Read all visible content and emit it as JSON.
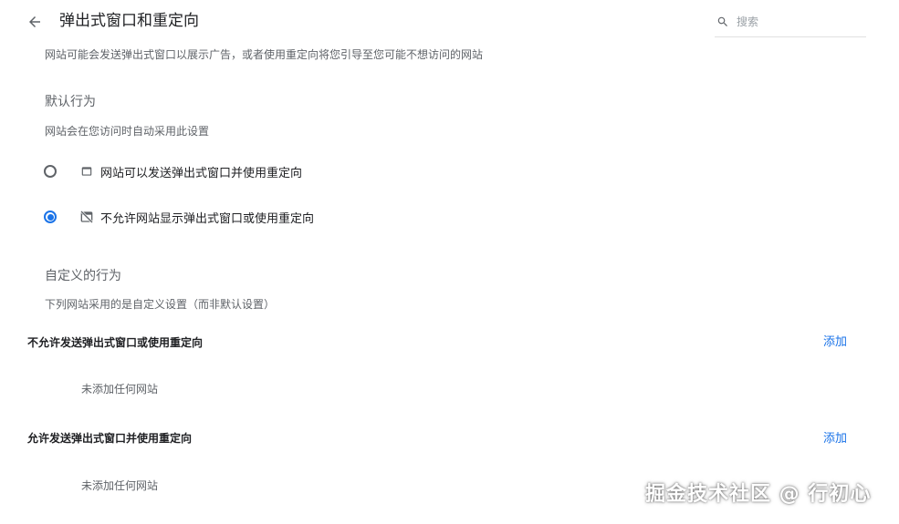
{
  "header": {
    "title": "弹出式窗口和重定向",
    "back_icon": "arrow-left-icon",
    "search": {
      "placeholder": "搜索",
      "value": "",
      "icon": "search-icon"
    }
  },
  "description": "网站可能会发送弹出式窗口以展示广告，或者使用重定向将您引导至您可能不想访问的网站",
  "default_behavior": {
    "heading": "默认行为",
    "subtext": "网站会在您访问时自动采用此设置",
    "options": [
      {
        "label": "网站可以发送弹出式窗口并使用重定向",
        "icon": "window-icon",
        "checked": false
      },
      {
        "label": "不允许网站显示弹出式窗口或使用重定向",
        "icon": "blocked-popup-icon",
        "checked": true
      }
    ]
  },
  "custom_behavior": {
    "heading": "自定义的行为",
    "subtext": "下列网站采用的是自定义设置（而非默认设置）",
    "lists": [
      {
        "title": "不允许发送弹出式窗口或使用重定向",
        "add_label": "添加",
        "empty_text": "未添加任何网站"
      },
      {
        "title": "允许发送弹出式窗口并使用重定向",
        "add_label": "添加",
        "empty_text": "未添加任何网站"
      }
    ]
  },
  "watermark": "掘金技术社区 @ 行初心",
  "colors": {
    "accent": "#1a73e8",
    "text_primary": "#202124",
    "text_secondary": "#5f6368"
  }
}
